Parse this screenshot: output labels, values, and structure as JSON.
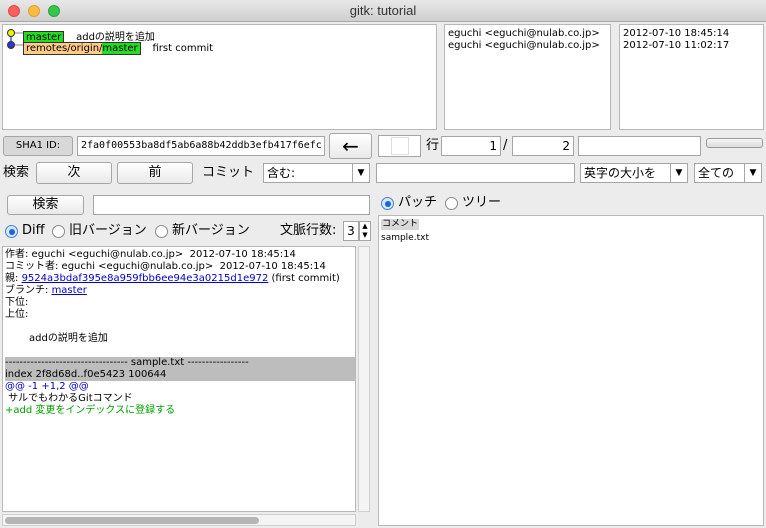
{
  "window": {
    "title": "gitk: tutorial"
  },
  "commits": [
    {
      "refs": [
        {
          "text": "master",
          "color": "#22dd22"
        }
      ],
      "message": "addの説明を追加",
      "author": "eguchi <eguchi@nulab.co.jp>",
      "date": "2012-07-10 18:45:14",
      "node_color": "#f0f000"
    },
    {
      "refs": [
        {
          "text": "remotes/origin/",
          "color": "#ffcc88"
        },
        {
          "text": "master",
          "color": "#22dd22"
        }
      ],
      "message": "first commit",
      "author": "eguchi <eguchi@nulab.co.jp>",
      "date": "2012-07-10 11:02:17",
      "node_color": "#3333cc"
    }
  ],
  "sha_bar": {
    "label": "SHA1 ID:",
    "value": "2fa0f00553ba8df5ab6a88b42ddb3efb417f6efc",
    "back_arrow": "←",
    "row_label": "行",
    "current_row": "1",
    "separator": "/",
    "total_rows": "2"
  },
  "find_bar": {
    "label": "検索",
    "next_label": "次",
    "prev_label": "前",
    "commit_label": "コミット",
    "match_mode": "含む:",
    "case_option": "英字の大小を",
    "field_option": "全ての"
  },
  "search": {
    "button_label": "検索"
  },
  "diff_options": {
    "diff_label": "Diff",
    "old_label": "旧バージョン",
    "new_label": "新バージョン",
    "context_label": "文脈行数:",
    "context_value": "3"
  },
  "details": {
    "author_line": "作者: eguchi <eguchi@nulab.co.jp>  2012-07-10 18:45:14",
    "committer_line": "コミット者: eguchi <eguchi@nulab.co.jp>  2012-07-10 18:45:14",
    "parent_label": "親:",
    "parent_sha": "9524a3bdaf395e8a959fbb6ee94e3a0215d1e972",
    "parent_msg": "(first commit)",
    "branch_label": "ブランチ:",
    "branch_value": "master",
    "follows_label": "下位:",
    "precedes_label": "上位:",
    "message": "addの説明を追加",
    "file_header": "---------------------------------- sample.txt -----------------",
    "index_line": "index 2f8d68d..f0e5423 100644",
    "hunk_line": "@@ -1 +1,2 @@",
    "context_line": " サルでもわかるGitコマンド",
    "added_line": "+add 変更をインデックスに登録する"
  },
  "file_pane": {
    "patch_label": "パッチ",
    "tree_label": "ツリー",
    "items": [
      "コメント",
      "sample.txt"
    ]
  }
}
